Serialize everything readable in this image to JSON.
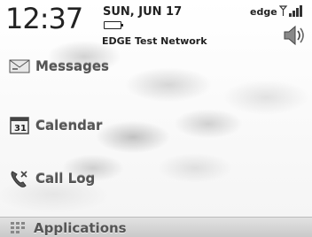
{
  "status_bar": {
    "time": "12:37",
    "date": "SUN, JUN 17",
    "network_name": "EDGE Test Network",
    "carrier_label": "edge",
    "signal_bars": 4
  },
  "menu": {
    "items": [
      {
        "label": "Messages",
        "icon": "envelope-icon"
      },
      {
        "label": "Calendar",
        "icon": "calendar-icon",
        "badge": "31"
      },
      {
        "label": "Call Log",
        "icon": "phone-icon"
      }
    ],
    "apps": {
      "label": "Applications",
      "icon": "apps-icon"
    }
  }
}
